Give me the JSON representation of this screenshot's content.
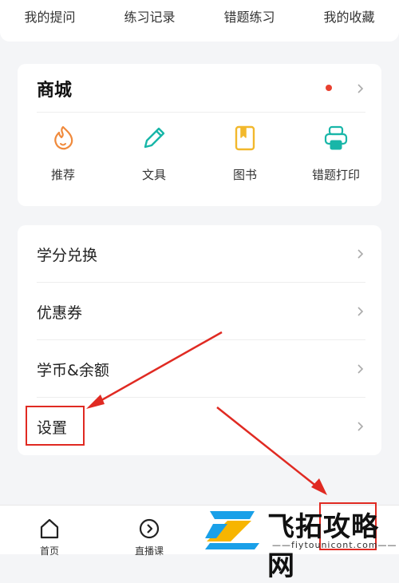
{
  "top_tabs": [
    "我的提问",
    "练习记录",
    "错题练习",
    "我的收藏"
  ],
  "mall": {
    "title": "商城",
    "items": [
      {
        "label": "推荐",
        "icon": "flame-icon"
      },
      {
        "label": "文具",
        "icon": "pen-icon"
      },
      {
        "label": "图书",
        "icon": "book-icon"
      },
      {
        "label": "错题打印",
        "icon": "printer-icon"
      }
    ]
  },
  "menu": {
    "items": [
      "学分兑换",
      "优惠券",
      "学币&余额",
      "设置"
    ]
  },
  "bottom_nav": {
    "items": [
      "首页",
      "直播课"
    ]
  },
  "watermark": {
    "text": "飞拓攻略网",
    "url": "——fiytounicont.com——"
  },
  "colors": {
    "accent_orange": "#f08a3c",
    "accent_teal": "#18b6a8",
    "accent_yellow": "#f2b82c",
    "annotation_red": "#e02a22"
  }
}
